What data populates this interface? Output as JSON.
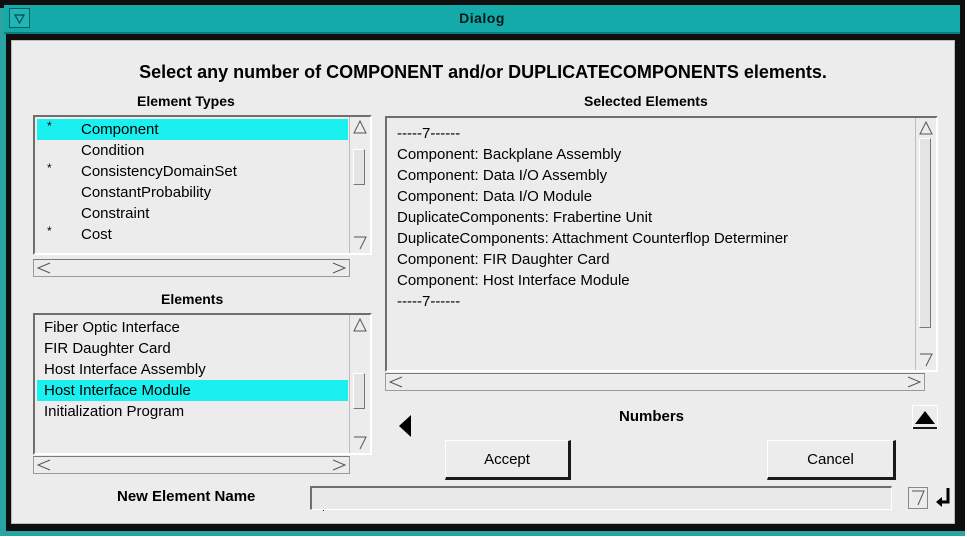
{
  "window": {
    "title": "Dialog"
  },
  "instruction": "Select any number of COMPONENT and/or DUPLICATECOMPONENTS elements.",
  "element_types": {
    "label": "Element Types",
    "items": [
      {
        "mark": "*",
        "label": "Component",
        "selected": true
      },
      {
        "mark": "",
        "label": "Condition",
        "selected": false
      },
      {
        "mark": "*",
        "label": "ConsistencyDomainSet",
        "selected": false
      },
      {
        "mark": "",
        "label": "ConstantProbability",
        "selected": false
      },
      {
        "mark": "",
        "label": "Constraint",
        "selected": false
      },
      {
        "mark": "*",
        "label": "Cost",
        "selected": false
      }
    ]
  },
  "elements": {
    "label": "Elements",
    "items": [
      {
        "label": "Fiber Optic Interface",
        "selected": false
      },
      {
        "label": "FIR Daughter Card",
        "selected": false
      },
      {
        "label": "Host Interface Assembly",
        "selected": false
      },
      {
        "label": "Host Interface Module",
        "selected": true
      },
      {
        "label": "Initialization Program",
        "selected": false
      }
    ]
  },
  "selected_elements": {
    "label": "Selected Elements",
    "lines": [
      "-----7------",
      "Component: Backplane Assembly",
      "Component: Data I/O Assembly",
      "Component: Data I/O Module",
      "DuplicateComponents: Frabertine Unit",
      "DuplicateComponents: Attachment Counterflop Determiner",
      "Component: FIR Daughter Card",
      "Component: Host Interface Module",
      "-----7------"
    ]
  },
  "navigation": {
    "label": "Numbers"
  },
  "buttons": {
    "accept": "Accept",
    "cancel": "Cancel"
  },
  "new_element_name": {
    "label": "New Element Name",
    "value": ""
  },
  "colors": {
    "titlebar": "#15aaaa",
    "selection": "#19f0ef",
    "background": "#ececec"
  }
}
